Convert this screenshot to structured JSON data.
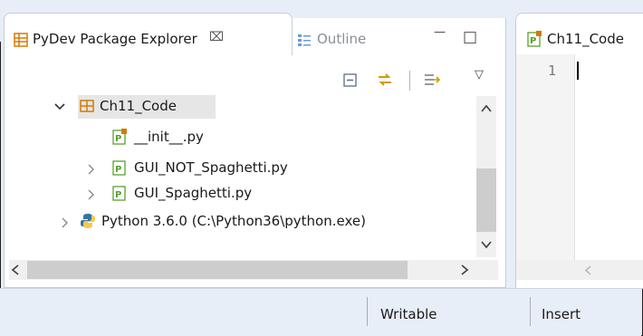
{
  "explorer": {
    "tab_label": "PyDev Package Explorer",
    "tab_close_glyph": "⌧",
    "outline_label": "Outline",
    "minimize_glyph": "—",
    "maximize_glyph": "□",
    "menu_glyph": "▽",
    "tree": [
      {
        "label": "Ch11_Code",
        "expanded": true,
        "icon": "package-icon"
      },
      {
        "label": "__init__.py",
        "icon": "python-file-icon"
      },
      {
        "label": "GUI_NOT_Spaghetti.py",
        "icon": "python-module-icon"
      },
      {
        "label": "GUI_Spaghetti.py",
        "icon": "python-module-icon"
      },
      {
        "label": "Python 3.6.0  (C:\\Python36\\python.exe)",
        "icon": "python-logo-icon"
      }
    ]
  },
  "editor": {
    "tab_label": "Ch11_Code",
    "line_number": "1"
  },
  "status": {
    "writable": "Writable",
    "insert": "Insert"
  },
  "colors": {
    "accent_orange": "#d47a00",
    "python_blue": "#3572a5",
    "python_yellow": "#f7c948",
    "file_green": "#5aa02c"
  }
}
